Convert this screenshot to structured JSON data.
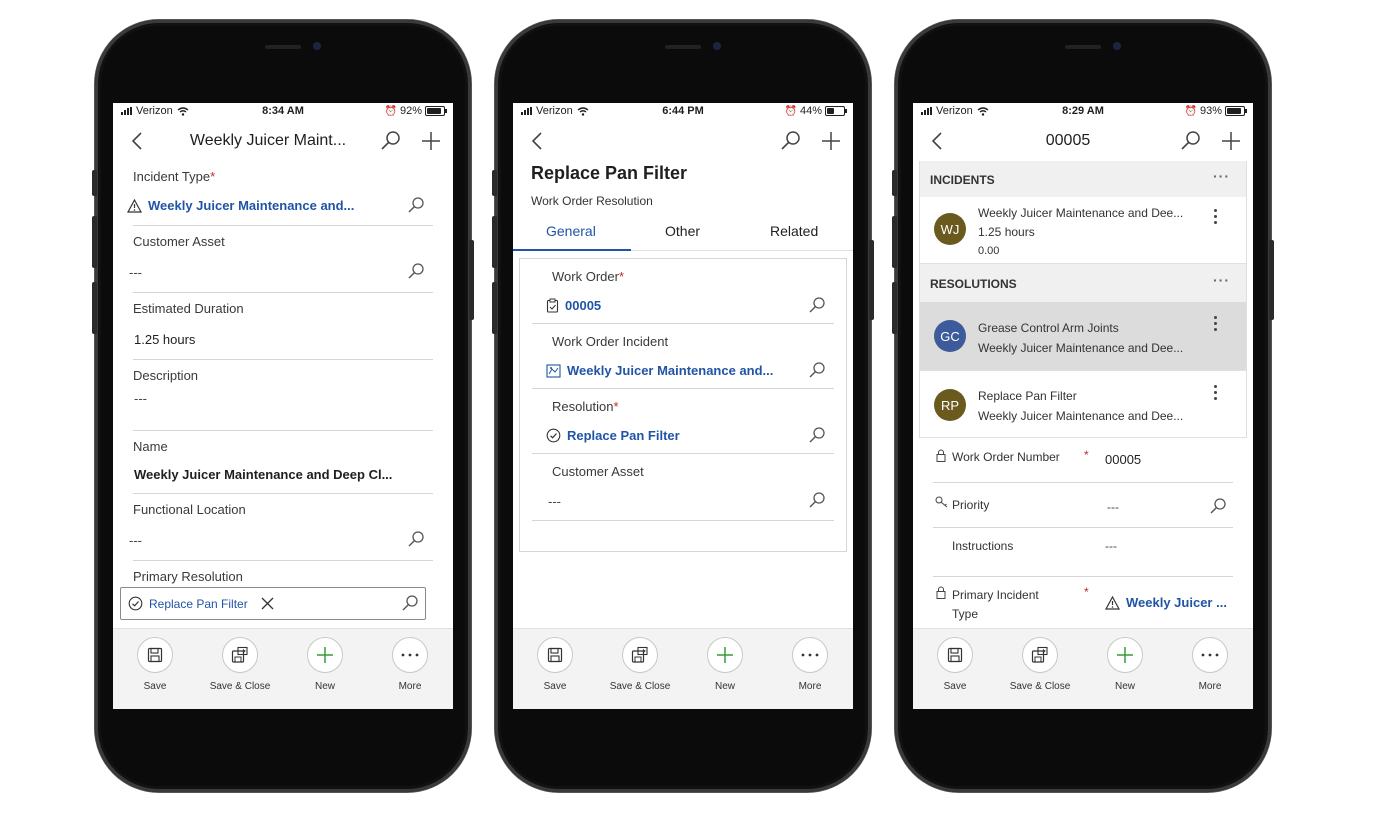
{
  "status": {
    "carrier": "Verizon",
    "phone1": {
      "time": "8:34 AM",
      "battery": "92%"
    },
    "phone2": {
      "time": "6:44 PM",
      "battery": "44%"
    },
    "phone3": {
      "time": "8:29 AM",
      "battery": "93%"
    }
  },
  "bottom_bar": {
    "save": "Save",
    "save_close": "Save & Close",
    "new": "New",
    "more": "More"
  },
  "phone1": {
    "header_title": "Weekly Juicer Maint...",
    "fields": {
      "incident_type_label": "Incident Type",
      "incident_type_value": "Weekly Juicer Maintenance and...",
      "customer_asset_label": "Customer Asset",
      "customer_asset_value": "---",
      "estimated_duration_label": "Estimated Duration",
      "estimated_duration_value": "1.25 hours",
      "description_label": "Description",
      "description_value": "---",
      "name_label": "Name",
      "name_value": "Weekly Juicer Maintenance and Deep Cl...",
      "functional_location_label": "Functional Location",
      "functional_location_value": "---",
      "primary_resolution_label": "Primary Resolution",
      "primary_resolution_value": "Replace Pan Filter"
    },
    "required_mark": "*"
  },
  "phone2": {
    "page_title": "Replace Pan Filter",
    "page_subtitle": "Work Order Resolution",
    "tabs": [
      "General",
      "Other",
      "Related"
    ],
    "fields": {
      "work_order_label": "Work Order",
      "work_order_value": "00005",
      "work_order_incident_label": "Work Order Incident",
      "work_order_incident_value": "Weekly Juicer Maintenance and...",
      "resolution_label": "Resolution",
      "resolution_value": "Replace Pan Filter",
      "customer_asset_label": "Customer Asset",
      "customer_asset_value": "---"
    },
    "required_mark": "*"
  },
  "phone3": {
    "header_title": "00005",
    "incidents_heading": "INCIDENTS",
    "resolutions_heading": "RESOLUTIONS",
    "section_menu": "···",
    "incident": {
      "initials": "WJ",
      "title": "Weekly Juicer Maintenance and Dee...",
      "duration": "1.25 hours",
      "amount": "0.00",
      "color": "#6b5a1e"
    },
    "resolutions": [
      {
        "initials": "GC",
        "title": "Grease Control Arm Joints",
        "subtitle": "Weekly Juicer Maintenance and Dee...",
        "color": "#3d5a9a"
      },
      {
        "initials": "RP",
        "title": "Replace Pan Filter",
        "subtitle": "Weekly Juicer Maintenance and Dee...",
        "color": "#6b5a1e"
      }
    ],
    "fields": {
      "work_order_number_label": "Work Order Number",
      "work_order_number_value": "00005",
      "priority_label": "Priority",
      "priority_value": "---",
      "instructions_label": "Instructions",
      "instructions_value": "---",
      "primary_incident_type_label_1": "Primary Incident",
      "primary_incident_type_label_2": "Type",
      "primary_incident_type_value": "Weekly Juicer ..."
    },
    "required_mark": "*"
  },
  "colors": {
    "accent": "#2154a6",
    "required": "#c4262e",
    "add_green": "#3a9a3a"
  }
}
